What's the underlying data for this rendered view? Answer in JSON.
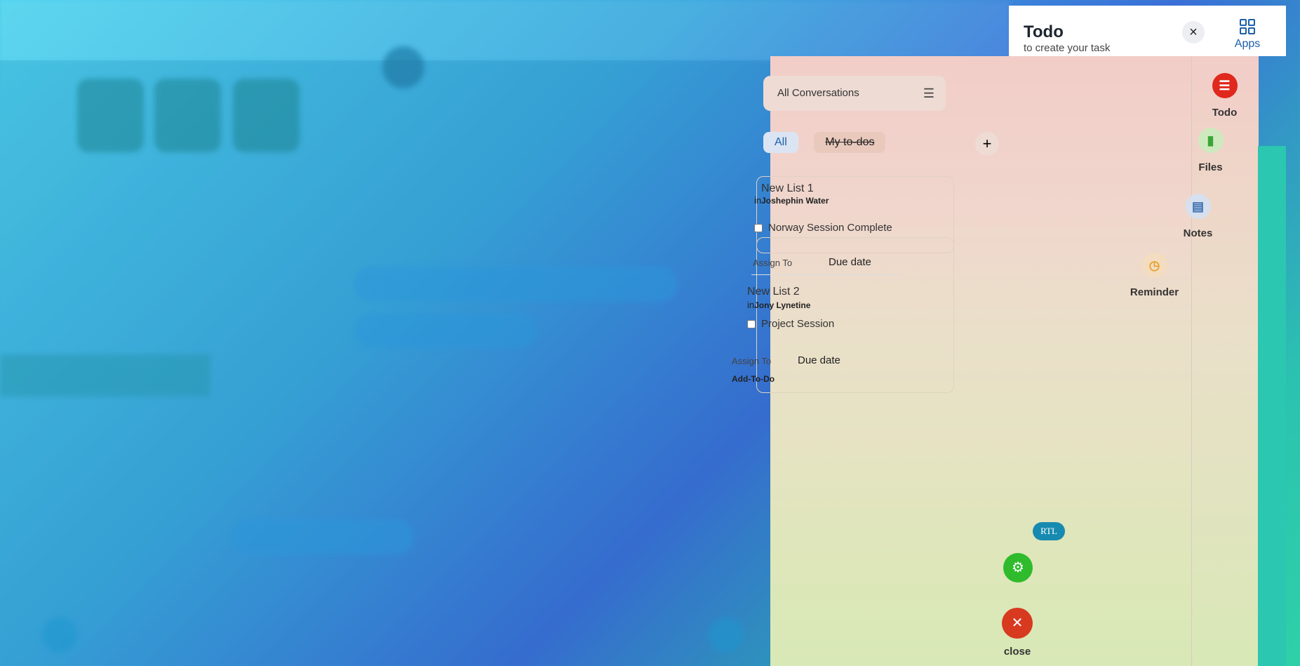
{
  "panel": {
    "title": "Todo",
    "subtitle": "to create your task",
    "close_icon": "×",
    "apps_label": "Apps"
  },
  "filter": {
    "value": "All Conversations"
  },
  "chips": {
    "all": "All",
    "my": "My to-dos",
    "add": "+"
  },
  "lists": [
    {
      "title": "New List 1",
      "in_prefix": "in",
      "owner": "Joshephin Water",
      "task": "Norway Session Complete",
      "assign": "Assign To",
      "due": "Due date"
    },
    {
      "title": "New List 2",
      "in_prefix": "in",
      "owner": "Jony Lynetine",
      "task": "Project Session",
      "assign": "Assign To",
      "due": "Due date",
      "add": "Add-To-Do"
    }
  ],
  "rail": {
    "todo": "Todo",
    "files": "Files",
    "notes": "Notes",
    "reminder": "Reminder"
  },
  "bottom": {
    "rtl": "RTL",
    "close_label": "close"
  },
  "colors": {
    "accent_blue": "#1b5fa8",
    "todo_red": "#e0281c",
    "gear_green": "#2fbb2c",
    "close_red": "#d73a1f"
  }
}
